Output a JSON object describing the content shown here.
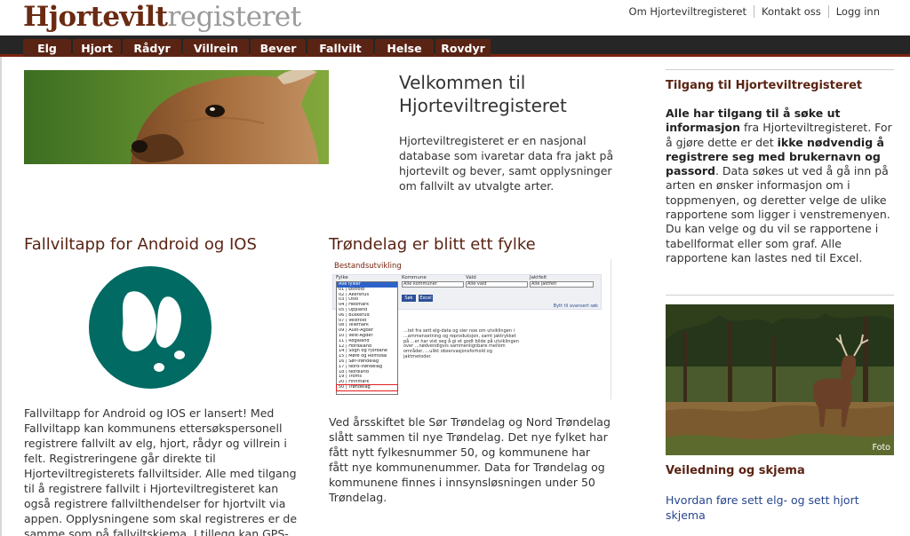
{
  "logo": {
    "bold": "Hjortevilt",
    "light": "registeret"
  },
  "toplinks": [
    "Om Hjorteviltregisteret",
    "Kontakt oss",
    "Logg inn"
  ],
  "nav": [
    "Elg",
    "Hjort",
    "Rådyr",
    "Villrein",
    "Bever",
    "Fallvilt",
    "Helse",
    "Rovdyr"
  ],
  "welcome": {
    "title": "Velkommen til Hjorteviltregisteret",
    "text": "Hjorteviltregisteret er en nasjonal database som ivaretar data fra jakt på hjortevilt og bever, samt opplysninger om fallvilt av utvalgte arter."
  },
  "app": {
    "title": "Fallviltapp for Android og IOS",
    "text": "Fallviltapp for Android og IOS er lansert! Med Fallviltapp kan kommunens ettersøkspersonell registrere fallvilt av elg, hjort, rådyr og villrein i felt. Registreringene går direkte til Hjorteviltregisterets fallviltsider. Alle med tilgang til å registrere fallvilt i Hjorteviltregisteret kan også registrere fallvilthendelser for hjortvilt via appen. Opplysningene som skal registreres er de samme som på fallviltskjema. I tillegg kan GPS-posisjon"
  },
  "trondelag": {
    "title": "Trøndelag er blitt ett fylke",
    "text": "Ved årsskiftet ble Sør Trøndelag og Nord Trøndelag slått sammen til nye Trøndelag. Det nye fylket har fått nytt fylkesnummer 50, og kommunene har fått nye kommunenummer. Data for Trøndelag og kommunene finnes i innsynsløsningen under 50 Trøndelag.",
    "screenshot": {
      "title": "Bestandsutvikling",
      "labels": [
        "Fylke",
        "Kommune",
        "Vald",
        "Jaktfelt"
      ],
      "selects": [
        "Alle fylker",
        "Alle kommuner",
        "Alle vald",
        "Alle jaktfelt"
      ],
      "buttons": [
        "Søk",
        "Excel"
      ],
      "link": "Bytt til avansert søk",
      "dropdown": [
        "Alle fylker",
        "01 | Østfold",
        "02 | Akershus",
        "03 | Oslo",
        "04 | Hedmark",
        "05 | Oppland",
        "06 | Buskerud",
        "07 | Vestfold",
        "08 | Telemark",
        "09 | Aust-Agder",
        "10 | Vest-Agder",
        "11 | Rogaland",
        "12 | Hordaland",
        "14 | Sogn og Fjordane",
        "15 | Møre og Romsdal",
        "16 | Sør-Trøndelag",
        "17 | Nord-Trøndelag",
        "18 | Nordland",
        "19 | Troms",
        "20 | Finnmark",
        "50 | Trøndelag"
      ],
      "note": "...tet fra sett elg-data og sier noe om utviklingen i ...ammensetning og reproduksjon, samt jaktrykket på ...er har vist seg å gi et godt bilde på utviklingen over ...nødvendigvis sammenlignbare mellom områder, ...ulikt observasjonsforhold og jaktmetoder."
    }
  },
  "sidebar": {
    "access_title": "Tilgang til Hjorteviltregisteret",
    "access_parts": [
      {
        "t": "Alle har tilgang til å søke ut informasjon",
        "b": true
      },
      {
        "t": " fra Hjorteviltregisteret. For å gjøre dette er det ",
        "b": false
      },
      {
        "t": "ikke nødvendig å registrere seg med brukernavn og passord",
        "b": true
      },
      {
        "t": ". Data søkes ut ved å gå inn på arten en ønsker informasjon om i toppmenyen, og deretter velge de ulike rapportene som ligger i venstremenyen. Du kan velge og du vil se rapportene i tabellformat eller som graf. Alle rapportene kan lastes ned til Excel.",
        "b": false
      }
    ],
    "photo_credit": "Foto",
    "guide_title": "Veiledning og skjema",
    "guide_link": "Hvordan føre sett elg- og sett hjort skjema"
  },
  "colors": {
    "brand": "#5a2414",
    "nav_bg": "#262626",
    "link": "#27468f",
    "app_icon": "#006a63"
  }
}
